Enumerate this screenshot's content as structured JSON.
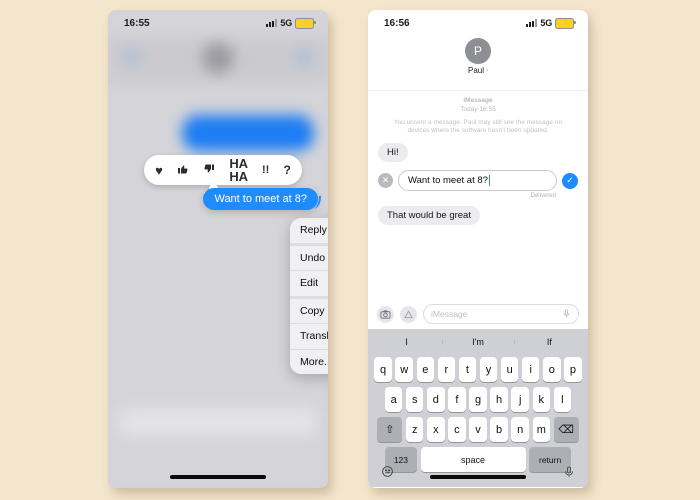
{
  "canvas": {
    "background": "#f4e5cd"
  },
  "left_phone": {
    "status": {
      "time": "16:55",
      "network": "5G",
      "battery_charging": true
    },
    "reactions": [
      {
        "name": "heart",
        "glyph": "♥"
      },
      {
        "name": "thumbs-up",
        "glyph": "👍"
      },
      {
        "name": "thumbs-down",
        "glyph": "👎"
      },
      {
        "name": "haha",
        "glyph": "HA\nHA"
      },
      {
        "name": "exclamation",
        "glyph": "!!"
      },
      {
        "name": "question",
        "glyph": "?"
      }
    ],
    "focused_message": "Want to meet at 8?",
    "context_menu": [
      {
        "label": "Reply",
        "icon": "reply-arrow-icon"
      },
      {
        "label": "Undo Send",
        "icon": "undo-clock-icon"
      },
      {
        "label": "Edit",
        "icon": "pencil-icon"
      },
      {
        "label": "Copy",
        "icon": "copy-document-icon"
      },
      {
        "label": "Translate",
        "icon": "translate-bubbles-icon"
      },
      {
        "label": "More...",
        "icon": "more-circle-icon"
      }
    ]
  },
  "right_phone": {
    "status": {
      "time": "16:56",
      "network": "5G",
      "battery_charging": true
    },
    "contact": {
      "name": "Paul",
      "initial": "P",
      "chevron": "›"
    },
    "thread": {
      "service_label": "iMessage",
      "timestamp": "Today 16:55",
      "unsent_note": "You unsent a message. Paul may still see the message on devices where the software hasn't been updated.",
      "incoming_first": "Hi!",
      "edit_value": "Want to meet at 8?",
      "delivered_label": "Delivered",
      "incoming_second": "That would be great"
    },
    "input_bar": {
      "placeholder": "iMessage"
    },
    "keyboard": {
      "predictions": [
        "I",
        "I'm",
        "If"
      ],
      "row1": [
        "q",
        "w",
        "e",
        "r",
        "t",
        "y",
        "u",
        "i",
        "o",
        "p"
      ],
      "row2": [
        "a",
        "s",
        "d",
        "f",
        "g",
        "h",
        "j",
        "k",
        "l"
      ],
      "row3": [
        "z",
        "x",
        "c",
        "v",
        "b",
        "n",
        "m"
      ],
      "shift_label": "⇧",
      "backspace_label": "⌫",
      "numbers_label": "123",
      "space_label": "space",
      "return_label": "return"
    }
  },
  "colors": {
    "bubble_blue": "#1e8bff",
    "bubble_gray": "#ececee",
    "keyboard_bg": "#cfd0d5"
  }
}
